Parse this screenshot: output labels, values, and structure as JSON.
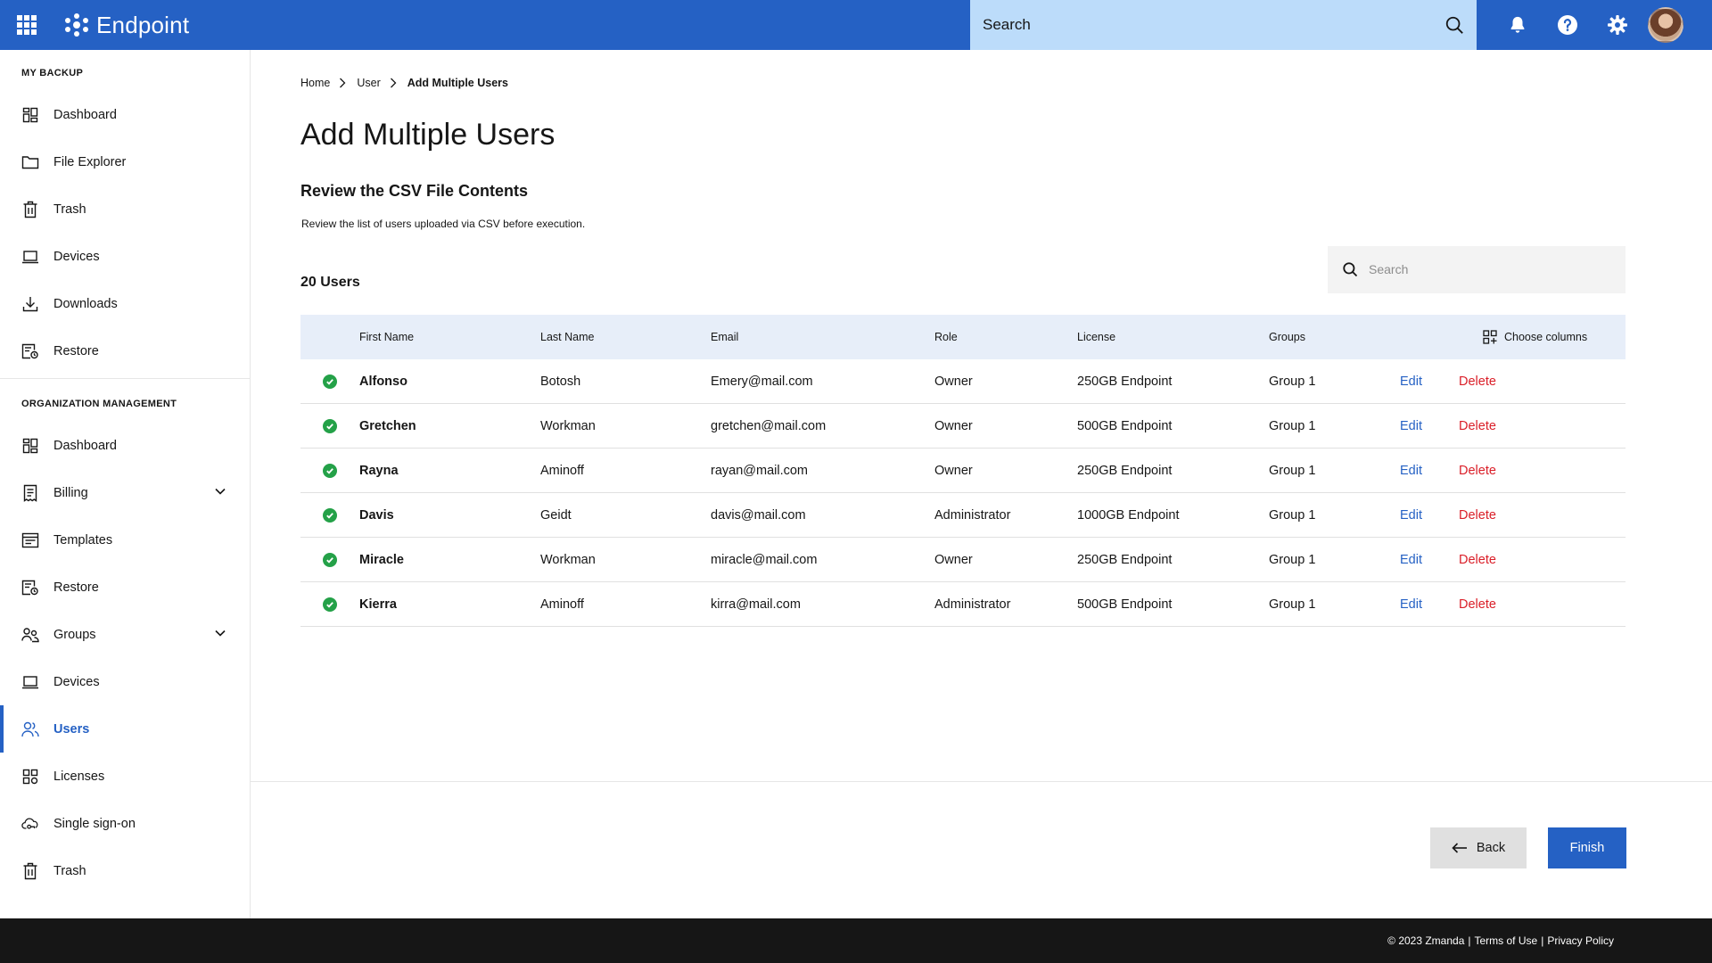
{
  "app": {
    "brand": "Endpoint"
  },
  "topbar": {
    "search_placeholder": "Search"
  },
  "sidebar": {
    "sections": [
      {
        "title": "MY BACKUP",
        "items": [
          {
            "label": "Dashboard",
            "icon": "dashboard-icon"
          },
          {
            "label": "File Explorer",
            "icon": "folder-icon"
          },
          {
            "label": "Trash",
            "icon": "trash-icon"
          },
          {
            "label": "Devices",
            "icon": "laptop-icon"
          },
          {
            "label": "Downloads",
            "icon": "download-icon"
          },
          {
            "label": "Restore",
            "icon": "restore-icon"
          }
        ]
      },
      {
        "title": "ORGANIZATION MANAGEMENT",
        "items": [
          {
            "label": "Dashboard",
            "icon": "dashboard-icon"
          },
          {
            "label": "Billing",
            "icon": "receipt-icon",
            "expandable": true
          },
          {
            "label": "Templates",
            "icon": "template-icon"
          },
          {
            "label": "Restore",
            "icon": "restore-icon"
          },
          {
            "label": "Groups",
            "icon": "groups-icon",
            "expandable": true
          },
          {
            "label": "Devices",
            "icon": "laptop-icon"
          },
          {
            "label": "Users",
            "icon": "users-icon",
            "active": true
          },
          {
            "label": "Licenses",
            "icon": "licenses-icon"
          },
          {
            "label": "Single sign-on",
            "icon": "cloud-key-icon"
          },
          {
            "label": "Trash",
            "icon": "trash-icon"
          }
        ]
      }
    ]
  },
  "breadcrumb": [
    "Home",
    "User",
    "Add Multiple Users"
  ],
  "page": {
    "title": "Add Multiple Users",
    "subtitle": "Review the CSV File Contents",
    "description": "Review the list of users uploaded via CSV before execution.",
    "user_count": "20 Users",
    "search_placeholder": "Search"
  },
  "table": {
    "headers": [
      "First Name",
      "Last Name",
      "Email",
      "Role",
      "License",
      "Groups"
    ],
    "choose_columns": "Choose columns",
    "edit_label": "Edit",
    "delete_label": "Delete",
    "rows": [
      {
        "first": "Alfonso",
        "last": "Botosh",
        "email": "Emery@mail.com",
        "role": "Owner",
        "license": "250GB Endpoint",
        "group": "Group 1"
      },
      {
        "first": "Gretchen",
        "last": "Workman",
        "email": "gretchen@mail.com",
        "role": "Owner",
        "license": "500GB Endpoint",
        "group": "Group 1"
      },
      {
        "first": "Rayna",
        "last": "Aminoff",
        "email": "rayan@mail.com",
        "role": "Owner",
        "license": "250GB Endpoint",
        "group": "Group 1"
      },
      {
        "first": "Davis",
        "last": "Geidt",
        "email": "davis@mail.com",
        "role": "Administrator",
        "license": "1000GB Endpoint",
        "group": "Group 1"
      },
      {
        "first": "Miracle",
        "last": "Workman",
        "email": "miracle@mail.com",
        "role": "Owner",
        "license": "250GB Endpoint",
        "group": "Group 1"
      },
      {
        "first": "Kierra",
        "last": "Aminoff",
        "email": "kirra@mail.com",
        "role": "Administrator",
        "license": "500GB Endpoint",
        "group": "Group 1"
      }
    ]
  },
  "actions": {
    "back": "Back",
    "finish": "Finish"
  },
  "footer": {
    "copyright": "© 2023 Zmanda",
    "terms": "Terms of Use",
    "privacy": "Privacy Policy"
  },
  "colors": {
    "primary": "#2561c4",
    "search_bg": "#bcdcfa",
    "success": "#24a148",
    "danger": "#da1e28",
    "footer_bg": "#161616"
  }
}
